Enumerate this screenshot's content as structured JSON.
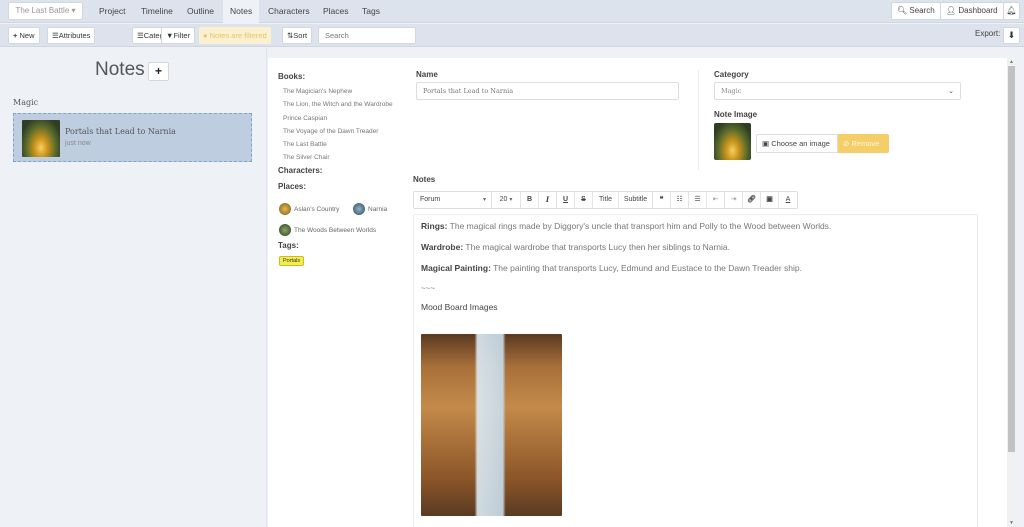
{
  "topnav": {
    "project": "The Last Battle",
    "tabs": [
      {
        "label": "Project",
        "active": false
      },
      {
        "label": "Timeline",
        "active": false
      },
      {
        "label": "Outline",
        "active": false
      },
      {
        "label": "Notes",
        "active": true
      },
      {
        "label": "Characters",
        "active": false
      },
      {
        "label": "Places",
        "active": false
      },
      {
        "label": "Tags",
        "active": false
      }
    ],
    "search_label": "Search",
    "dashboard_label": "Dashboard"
  },
  "toolbar": {
    "new_label": "New",
    "attributes_label": "Attributes",
    "categories_label": "Categories",
    "filter_label": "Filter",
    "filtered_notice": "Notes are filtered",
    "sort_label": "Sort",
    "search_placeholder": "Search",
    "export_label": "Export:"
  },
  "sidebar": {
    "title": "Notes",
    "category": "Magic",
    "notes": [
      {
        "title": "Portals that Lead to Narnia",
        "time": "just now"
      }
    ]
  },
  "info": {
    "books_heading": "Books:",
    "books": [
      "The Magician's Nephew",
      "The Lion, the Witch and the Wardrobe",
      "Prince Caspian",
      "The Voyage of the Dawn Treader",
      "The Last Battle",
      "The Silver Chair"
    ],
    "characters_heading": "Characters:",
    "places_heading": "Places:",
    "places": [
      "Aslan's Country",
      "Narnia",
      "The Woods Between Worlds"
    ],
    "tags_heading": "Tags:",
    "tags": [
      "Portals"
    ]
  },
  "form": {
    "name_label": "Name",
    "name_value": "Portals that Lead to Narnia",
    "category_label": "Category",
    "category_value": "Magic",
    "image_label": "Note Image",
    "choose_label": "Choose an image",
    "remove_label": "Remove",
    "notes_label": "Notes"
  },
  "editor_toolbar": {
    "font": "Forum",
    "size": "20",
    "title_label": "Title",
    "subtitle_label": "Subtitle"
  },
  "editor": {
    "paragraphs": [
      {
        "term": "Rings:",
        "text": " The magical rings made by Diggory's uncle that transport him and Polly to the Wood between Worlds."
      },
      {
        "term": "Wardrobe:",
        "text": " The magical wardrobe that transports Lucy then her siblings to Narnia."
      },
      {
        "term": "Magical Painting:",
        "text": " The painting that transports Lucy, Edmund and Eustace to the Dawn Treader ship."
      }
    ],
    "separator": "~~~",
    "heading": "Mood Board Images"
  },
  "colors": {
    "nav_bg": "#dde3ec",
    "selected_note": "#bfcde0",
    "warning": "#f3ce69",
    "tag": "#f3ed4d"
  }
}
